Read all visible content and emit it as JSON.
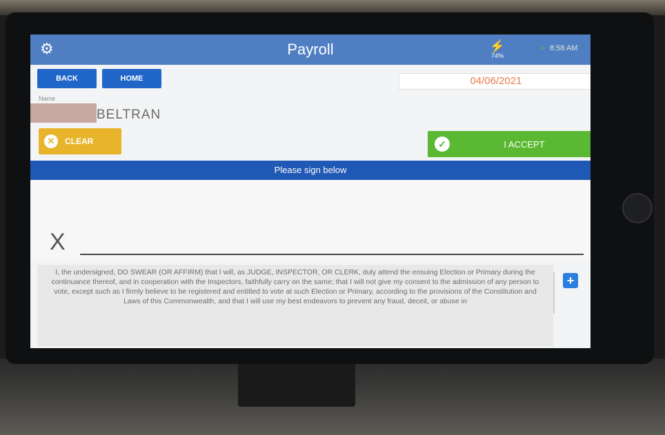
{
  "header": {
    "title": "Payroll",
    "battery": "74%",
    "time": "8:58 AM"
  },
  "nav": {
    "back_label": "BACK",
    "home_label": "HOME"
  },
  "date": "04/06/2021",
  "name": {
    "label": "Name",
    "value": "BELTRAN"
  },
  "actions": {
    "clear_label": "CLEAR",
    "accept_label": "I ACCEPT"
  },
  "signature": {
    "prompt": "Please sign below",
    "x_mark": "X"
  },
  "oath_text": "I, the undersigned, DO SWEAR (OR AFFIRM) that I will, as JUDGE, INSPECTOR, OR CLERK, duly attend the ensuing Election or Primary during the continuance thereof, and in cooperation with the Inspectors, faithfully carry on the same; that I will not give my consent to the admission of any person to vote, except such as I firmly believe to be registered and entitled to vote at such Election or Primary, according to the provisions of the Constitution and Laws of this Commonwealth, and that I will use my best endeavors to prevent any fraud, deceit, or abuse in",
  "colors": {
    "header_blue": "#4f7ec3",
    "button_blue": "#1f66c8",
    "clear_yellow": "#e8b42b",
    "accept_green": "#5ab832",
    "date_orange": "#e87b4a"
  }
}
